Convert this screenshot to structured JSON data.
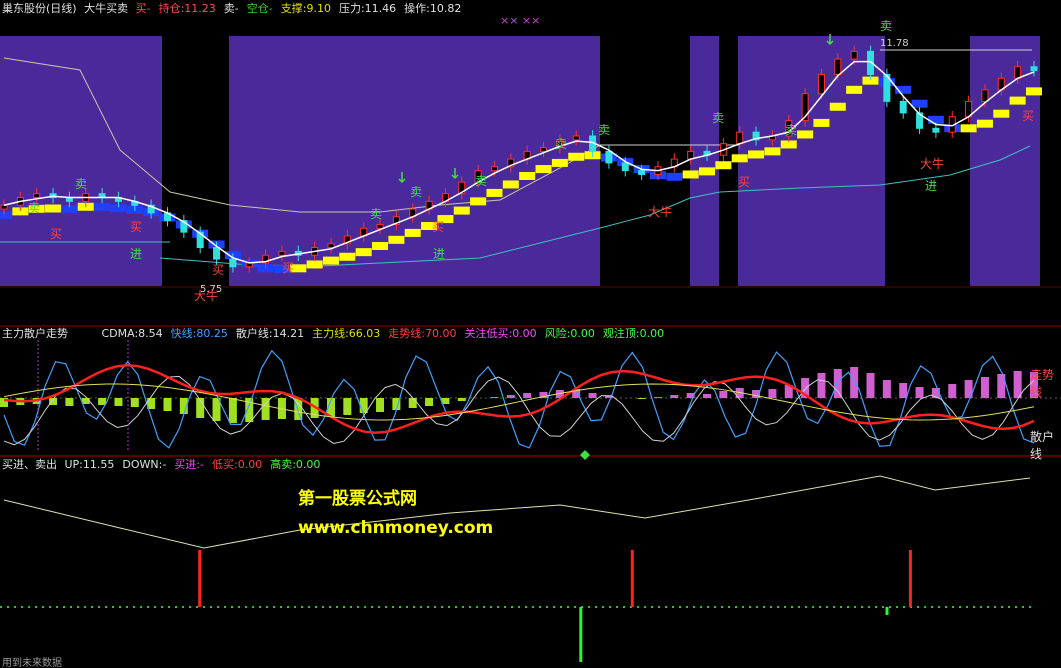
{
  "panel1": {
    "stock": "巢东股份(日线)",
    "indicator": "大牛买卖",
    "items": [
      {
        "label": "买-",
        "color": "#ff5050"
      },
      {
        "label": "持仓:11.23",
        "color": "#ff5050"
      },
      {
        "label": "卖-",
        "color": "#e0e0e0"
      },
      {
        "label": "空仓-",
        "color": "#40d040"
      },
      {
        "label": "支撑:9.10",
        "color": "#e0e000"
      },
      {
        "label": "压力:11.46",
        "color": "#e0e0e0"
      },
      {
        "label": "操作:10.82",
        "color": "#e0e0e0"
      }
    ],
    "markers_xx": "×× ××",
    "annotations": {
      "high": "11.78",
      "low": "5.75",
      "buy": "买",
      "sell": "卖",
      "enter": "进",
      "bull": "大牛"
    }
  },
  "panel2": {
    "title": "主力散户走势",
    "items": [
      {
        "label": "CDMA:8.54",
        "color": "#e0e0e0"
      },
      {
        "label": "快线:80.25",
        "color": "#40a0ff"
      },
      {
        "label": "散户线:14.21",
        "color": "#e0e0e0"
      },
      {
        "label": "主力线:66.03",
        "color": "#e0e000"
      },
      {
        "label": "走势线:70.00",
        "color": "#ff4040"
      },
      {
        "label": "关注低买:0.00",
        "color": "#ff40ff"
      },
      {
        "label": "风险:0.00",
        "color": "#40ff40"
      },
      {
        "label": "观注顶:0.00",
        "color": "#40ff40"
      }
    ],
    "right_labels": {
      "trend": "走势线",
      "retail": "散户线"
    }
  },
  "panel3": {
    "title": "买进、卖出",
    "items": [
      {
        "label": "UP:11.55",
        "color": "#e0e0e0"
      },
      {
        "label": "DOWN:-",
        "color": "#e0e0e0"
      },
      {
        "label": "买进:-",
        "color": "#ff40ff"
      },
      {
        "label": "低买:0.00",
        "color": "#ff4040"
      },
      {
        "label": "高卖:0.00",
        "color": "#40ff40"
      }
    ],
    "watermark1": "第一股票公式网",
    "watermark2": "www.chnmoney.com"
  },
  "footer": "用到未来数据",
  "colors": {
    "up": "#ff3030",
    "down": "#30e0e0",
    "bg": "#000000",
    "zone": "#4a2a9a",
    "ladder": "#ffff00",
    "blue": "#2040ff"
  },
  "chart_data": [
    {
      "type": "candlestick",
      "name": "price",
      "y_range": [
        5.5,
        12.0
      ],
      "support": 9.1,
      "resistance": 11.46,
      "hold": 11.23,
      "operate": 10.82,
      "annotated_high": 11.78,
      "annotated_low": 5.75,
      "close_estimate": [
        7.6,
        7.8,
        7.9,
        7.8,
        7.7,
        7.9,
        7.8,
        7.7,
        7.6,
        7.4,
        7.2,
        6.9,
        6.5,
        6.2,
        6.0,
        6.1,
        6.3,
        6.4,
        6.3,
        6.5,
        6.6,
        6.8,
        7.0,
        7.1,
        7.3,
        7.5,
        7.7,
        7.9,
        8.2,
        8.5,
        8.6,
        8.8,
        9.0,
        9.1,
        9.3,
        9.4,
        9.0,
        8.7,
        8.5,
        8.4,
        8.6,
        8.8,
        9.0,
        8.9,
        9.2,
        9.5,
        9.3,
        9.4,
        9.8,
        10.5,
        11.0,
        11.4,
        11.6,
        11.0,
        10.3,
        10.0,
        9.6,
        9.5,
        9.9,
        10.3,
        10.6,
        10.9,
        11.2,
        11.1
      ]
    },
    {
      "type": "line",
      "name": "主力散户走势",
      "y_range": [
        0,
        100
      ],
      "series": [
        {
          "name": "快线",
          "last": 80.25
        },
        {
          "name": "散户线",
          "last": 14.21
        },
        {
          "name": "主力线",
          "last": 66.03
        },
        {
          "name": "走势线",
          "last": 70.0
        }
      ]
    },
    {
      "type": "line",
      "name": "买进、卖出",
      "series": [
        {
          "name": "UP",
          "last": 11.55
        }
      ],
      "signal_bars_up": [
        0.19,
        0.61,
        0.88
      ],
      "signal_bars_down": [
        0.56
      ]
    }
  ]
}
